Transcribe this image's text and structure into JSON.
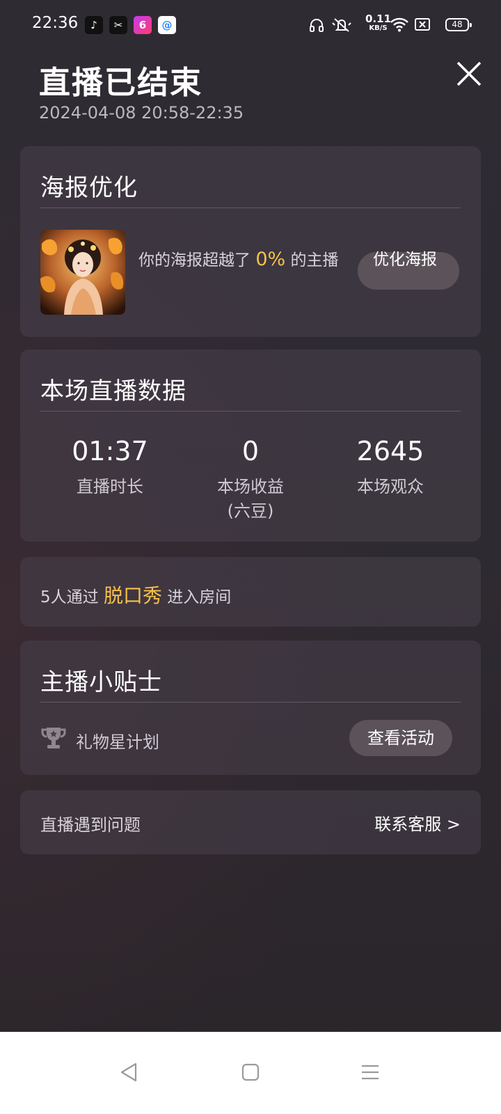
{
  "status_bar": {
    "time": "22:36",
    "net_speed_value": "0.11",
    "net_speed_unit": "KB/S",
    "battery": "48",
    "app_icons": [
      "tiktok-icon",
      "capcut-icon",
      "live-app-icon",
      "qq-browser-icon"
    ],
    "status_icons": [
      "headphones-icon",
      "mute-icon",
      "wifi-icon",
      "sim-off-icon"
    ]
  },
  "header": {
    "title": "直播已结束",
    "time_range": "2024-04-08 20:58-22:35"
  },
  "poster_card": {
    "title": "海报优化",
    "text_before": "你的海报超越了",
    "percent": "0%",
    "text_after": "的主播",
    "button_label": "优化海报"
  },
  "stats_card": {
    "title": "本场直播数据",
    "items": [
      {
        "value": "01:37",
        "label": "直播时长"
      },
      {
        "value": "0",
        "label": "本场收益\n(六豆)"
      },
      {
        "value": "2645",
        "label": "本场观众"
      }
    ]
  },
  "entry_card": {
    "count_text": "5人通过",
    "source": "脱口秀",
    "suffix": "进入房间"
  },
  "tips_card": {
    "title": "主播小贴士",
    "item_label": "礼物星计划",
    "item_icon": "trophy-icon",
    "button_label": "查看活动"
  },
  "problem_card": {
    "label": "直播遇到问题",
    "link": "联系客服 >"
  },
  "nav_bar": {
    "buttons": [
      "back-icon",
      "home-icon",
      "menu-icon"
    ]
  },
  "colors": {
    "accent": "#f6c04a",
    "card_bg": "#463e48",
    "button_bg": "#5b5359"
  }
}
